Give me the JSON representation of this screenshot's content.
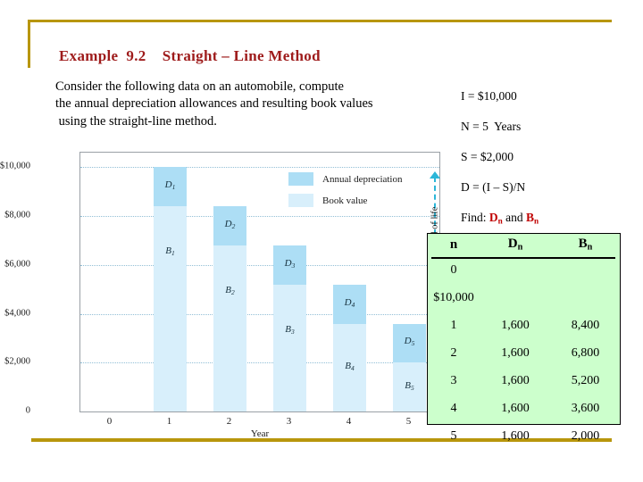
{
  "title": "Example  9.2    Straight – Line Method",
  "body_lines": [
    "Consider the following data on an automobile, compute",
    "the annual depreciation allowances and resulting book values",
    " using the straight-line method."
  ],
  "params": {
    "investment": "I = $10,000",
    "life": "N = 5  Years",
    "salvage": "S = $2,000",
    "formula": "D = (I – S)/N",
    "find_prefix": "Find: ",
    "find_d": "D",
    "find_d_sub": "n",
    "find_and": " and ",
    "find_b": "B",
    "find_b_sub": "n"
  },
  "table": {
    "headers": [
      {
        "text": "n",
        "sub": ""
      },
      {
        "text": "D",
        "sub": "n"
      },
      {
        "text": "B",
        "sub": "n"
      }
    ],
    "rows": [
      {
        "n": "0",
        "d": "",
        "b": ""
      },
      {
        "n": "$10,000",
        "d": "",
        "b": ""
      },
      {
        "n": "1",
        "d": "1,600",
        "b": "8,400"
      },
      {
        "n": "2",
        "d": "1,600",
        "b": "6,800"
      },
      {
        "n": "3",
        "d": "1,600",
        "b": "5,200"
      },
      {
        "n": "4",
        "d": "1,600",
        "b": "3,600"
      },
      {
        "n": "5",
        "d": "1,600",
        "b": "2,000"
      }
    ]
  },
  "colors": {
    "gold": "#b8960c",
    "title_red": "#9e1b1b",
    "accent_red": "#c00000",
    "table_green": "#ccffcc",
    "bar_depreciation": "#addef5",
    "bar_book_value": "#d8effb",
    "annotation_cyan": "#2bb6d8"
  },
  "chart_data": {
    "type": "bar",
    "title": "",
    "xlabel": "Year",
    "ylabel": "",
    "categories": [
      "1",
      "2",
      "3",
      "4",
      "5"
    ],
    "xtick_labels": [
      "0",
      "1",
      "2",
      "3",
      "4",
      "5"
    ],
    "ytick_labels": [
      "$10,000",
      "$8,000",
      "$6,000",
      "$4,000",
      "$2,000",
      "0"
    ],
    "ytick_values": [
      10000,
      8000,
      6000,
      4000,
      2000,
      0
    ],
    "ylim": [
      0,
      10600
    ],
    "grid": true,
    "legend_position": "upper-center",
    "stacked": true,
    "series": [
      {
        "name": "Book value",
        "values": [
          8400,
          6800,
          5200,
          3600,
          2000
        ],
        "labels": [
          "B1",
          "B2",
          "B3",
          "B4",
          "B5"
        ],
        "color": "#d8effb"
      },
      {
        "name": "Annual depreciation",
        "values": [
          1600,
          1600,
          1600,
          1600,
          1600
        ],
        "labels": [
          "D1",
          "D2",
          "D3",
          "D4",
          "D5"
        ],
        "color": "#addef5"
      }
    ],
    "bar_label_subscripts": {
      "book": [
        [
          "B",
          "1"
        ],
        [
          "B",
          "2"
        ],
        [
          "B",
          "3"
        ],
        [
          "B",
          "4"
        ],
        [
          "B",
          "5"
        ]
      ],
      "dep": [
        [
          "D",
          "1"
        ],
        [
          "D",
          "2"
        ],
        [
          "D",
          "3"
        ],
        [
          "D",
          "4"
        ],
        [
          "D",
          "5"
        ]
      ]
    },
    "annotations": [
      {
        "text": "Total depreciation at end of life",
        "from": 2000,
        "to": 10000,
        "style": "dashed-double-arrow",
        "color": "#2bb6d8"
      }
    ]
  }
}
